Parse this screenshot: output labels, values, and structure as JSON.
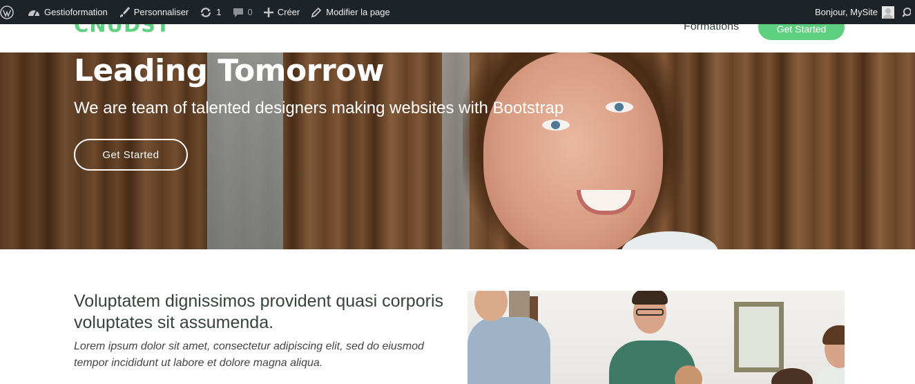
{
  "admin_bar": {
    "site_name": "Gestioformation",
    "customize": "Personnaliser",
    "updates_count": "1",
    "comments_count": "0",
    "new_label": "Créer",
    "edit_page": "Modifier la page",
    "greeting": "Bonjour, MySite",
    "icons": [
      "wordpress-logo-icon",
      "dashboard-icon",
      "brush-icon",
      "updates-icon",
      "comment-icon",
      "plus-icon",
      "pencil-icon",
      "avatar-icon",
      "search-icon"
    ]
  },
  "header": {
    "logo": "CNUDST",
    "nav": {
      "formations": "Formations"
    },
    "cta": "Get Started"
  },
  "hero": {
    "title": "Leading Tomorrow",
    "subtitle": "We are team of talented designers making websites with Bootstrap",
    "button": "Get Started"
  },
  "about": {
    "title": "Voluptatem dignissimos provident quasi corporis voluptates sit assumenda.",
    "lead": "Lorem ipsum dolor sit amet, consectetur adipiscing elit, sed do eiusmod tempor incididunt ut labore et dolore magna aliqua."
  },
  "colors": {
    "admin_bar_bg": "#1d2327",
    "accent_green": "#5fcf80",
    "heading_text": "#37423b"
  }
}
